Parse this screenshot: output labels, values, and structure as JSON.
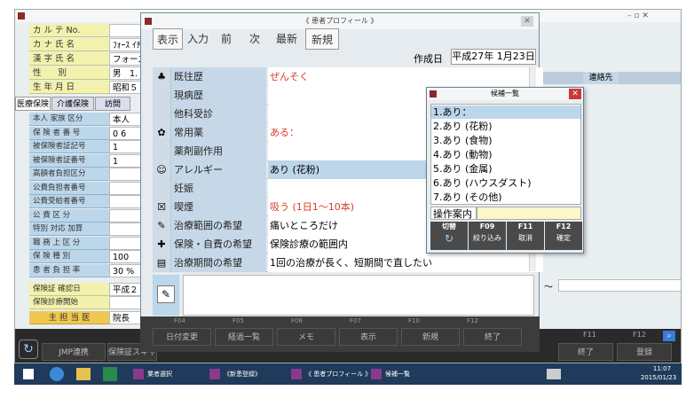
{
  "main_window": {
    "title": "《新患登録》",
    "controls": "–  ▫  ✕"
  },
  "patient_labels": [
    {
      "label": "カ ル テ No.",
      "value": ""
    },
    {
      "label": "カ ナ 氏 名",
      "value": "ﾌｫｰｽ ｲﾁﾛｳ"
    },
    {
      "label": "漢 字 氏 名",
      "value": "フォース一"
    },
    {
      "label": "性　　別",
      "value": "男　1."
    },
    {
      "label": "生 年 月 日",
      "value": "昭和５５年"
    }
  ],
  "insurance_tabs": [
    "医療保険",
    "介護保険",
    "訪問"
  ],
  "insurance_rows": [
    {
      "label": "本人 家族 区分",
      "value": "本人"
    },
    {
      "label": "保 険 者 番 号",
      "value": "0 6"
    },
    {
      "label": "被保険者証記号",
      "value": "1"
    },
    {
      "label": "被保険者証番号",
      "value": "1"
    },
    {
      "label": "高額者負担区分",
      "value": ""
    },
    {
      "label": "公費負担者番号",
      "value": ""
    },
    {
      "label": "公費受給者番号",
      "value": ""
    },
    {
      "label": "公 費 区 分",
      "value": ""
    },
    {
      "label": "特別 対応 加算",
      "value": ""
    },
    {
      "label": "職 務 上 区 分",
      "value": ""
    },
    {
      "label": "保 険 種 別",
      "value": "100"
    },
    {
      "label": "患 者 負 担 率",
      "value": "30 %"
    }
  ],
  "confirm_rows": [
    {
      "label": "保険証 確認日",
      "value": "平成２７年"
    },
    {
      "label": "保険診療開始",
      "value": ""
    }
  ],
  "doctor": {
    "label": "主 担 当 医",
    "value": "院長"
  },
  "right_labels": {
    "contact": "連絡先",
    "tilde": "～"
  },
  "profile": {
    "title": "《 患者プロフィール 》",
    "toolbar": [
      "表示",
      "入力",
      "前",
      "次",
      "最新",
      "新規"
    ],
    "created_label": "作成日",
    "created_value": "平成27年 1月23日",
    "rows": [
      {
        "icon": "♣",
        "label": "既往歴",
        "value": "ぜんそく",
        "red": true
      },
      {
        "icon": "",
        "label": "現病歴",
        "value": "",
        "red": false
      },
      {
        "icon": "",
        "label": "他科受診",
        "value": "",
        "red": false
      },
      {
        "icon": "✿",
        "label": "常用薬",
        "value": "ある：",
        "red": true
      },
      {
        "icon": "",
        "label": "薬剤副作用",
        "value": "",
        "red": false
      },
      {
        "icon": "☺",
        "label": "アレルギー",
        "value": "あり (花粉)",
        "red": false
      },
      {
        "icon": "",
        "label": "妊娠",
        "value": "",
        "red": false
      },
      {
        "icon": "☒",
        "label": "喫煙",
        "value": "吸う (1日1～10本)",
        "red": true
      },
      {
        "icon": "✎",
        "label": "治療範囲の希望",
        "value": "痛いところだけ",
        "red": false
      },
      {
        "icon": "✚",
        "label": "保険・自費の希望",
        "value": "保険診療の範囲内",
        "red": false
      },
      {
        "icon": "▤",
        "label": "治療期間の希望",
        "value": "1回の治療が長く、短期間で直したい",
        "red": false
      }
    ]
  },
  "candidates": {
    "title": "候補一覧",
    "items": [
      "1.あり：",
      "2.あり (花粉)",
      "3.あり (食物)",
      "4.あり (動物)",
      "5.あり (金属)",
      "6.あり (ハウスダスト)",
      "7.あり (その他)"
    ],
    "guide_label": "操作案内",
    "fkeys": [
      {
        "key": "切替",
        "label": ""
      },
      {
        "key": "F09",
        "label": "絞り込み"
      },
      {
        "key": "F11",
        "label": "取消"
      },
      {
        "key": "F12",
        "label": "確定"
      }
    ]
  },
  "profile_bottom_buttons": [
    "日付変更",
    "経過一覧",
    "メモ",
    "表示",
    "新規",
    "終了"
  ],
  "profile_fkeys": [
    "F04",
    "F05",
    "F06",
    "F07",
    "F10",
    "F12"
  ],
  "main_bottom_buttons": [
    "JMP連携",
    "保険証スキャン",
    "終了",
    "登録"
  ],
  "main_fkeys": [
    "F11",
    "F12"
  ],
  "taskbar": {
    "tasks": [
      "業者選択",
      "《新患登録》",
      "《 患者プロフィール 》",
      "候補一覧"
    ],
    "time": "11:07",
    "date": "2015/01/23"
  }
}
